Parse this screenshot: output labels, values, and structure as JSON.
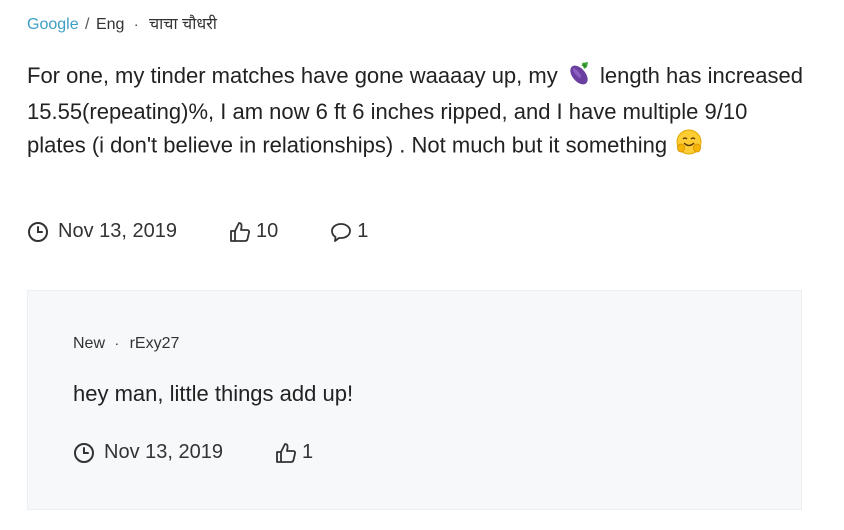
{
  "review": {
    "source": "Google",
    "separator": "/",
    "language": "Eng",
    "bullet": "·",
    "author": "चाचा चौधरी",
    "text_part1": "For one, my tinder matches have gone waaaay up, my",
    "text_part2": "length has increased 15.55(repeating)%, I am now 6 ft 6 inches ripped, and I have multiple 9/10 plates (i don't believe in relationships) . Not much but it something",
    "emoji_1": "eggplant-emoji",
    "emoji_2": "hugging-face-emoji",
    "date": "Nov 13, 2019",
    "likes": "10",
    "comments": "1"
  },
  "reply": {
    "label": "New",
    "bullet": "·",
    "author": "rExy27",
    "text": "hey man, little things add up!",
    "date": "Nov 13, 2019",
    "likes": "1"
  },
  "colors": {
    "source_link": "#3c9fc5",
    "reply_bg": "#f6f8fa",
    "text": "#222222"
  }
}
